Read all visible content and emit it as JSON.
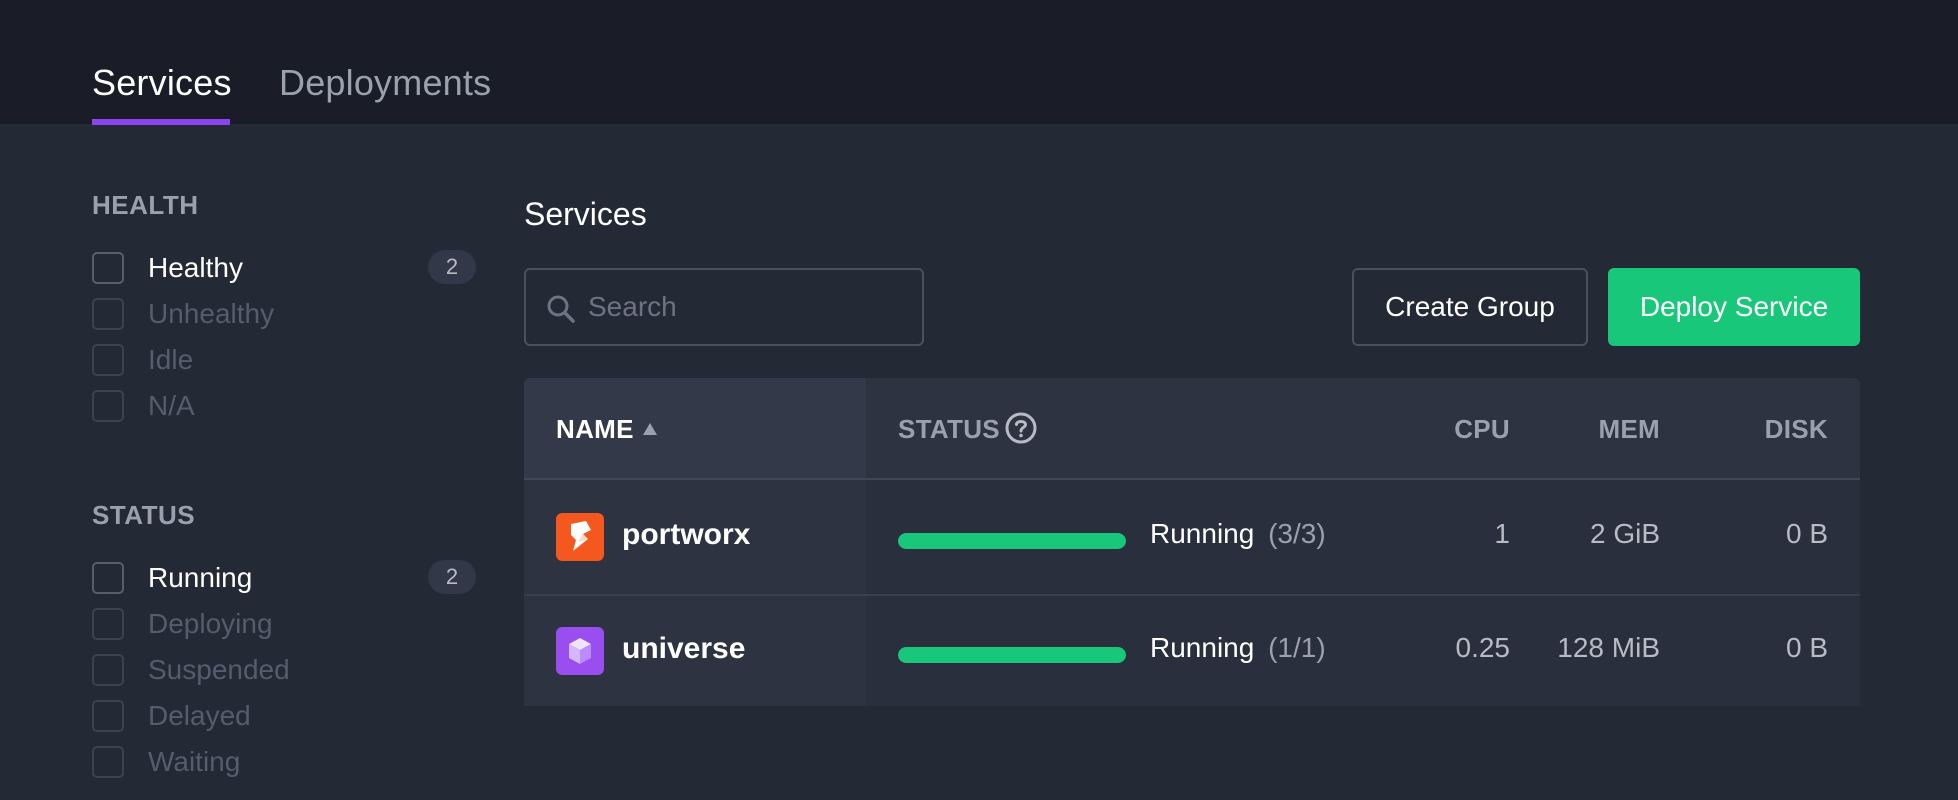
{
  "tabs": [
    {
      "label": "Services",
      "active": true
    },
    {
      "label": "Deployments",
      "active": false
    }
  ],
  "sidebar": {
    "health": {
      "title": "HEALTH",
      "items": [
        {
          "label": "Healthy",
          "count": "2",
          "enabled": true
        },
        {
          "label": "Unhealthy",
          "enabled": false
        },
        {
          "label": "Idle",
          "enabled": false
        },
        {
          "label": "N/A",
          "enabled": false
        }
      ]
    },
    "status": {
      "title": "STATUS",
      "items": [
        {
          "label": "Running",
          "count": "2",
          "enabled": true
        },
        {
          "label": "Deploying",
          "enabled": false
        },
        {
          "label": "Suspended",
          "enabled": false
        },
        {
          "label": "Delayed",
          "enabled": false
        },
        {
          "label": "Waiting",
          "enabled": false
        }
      ]
    }
  },
  "main": {
    "title": "Services",
    "search": {
      "placeholder": "Search",
      "value": ""
    },
    "buttons": {
      "create_group": "Create Group",
      "deploy_service": "Deploy Service"
    }
  },
  "table": {
    "headers": {
      "name": "NAME",
      "status": "STATUS",
      "cpu": "CPU",
      "mem": "MEM",
      "disk": "DISK"
    },
    "sort": {
      "column": "name",
      "direction": "ascending",
      "icon": "sort-ascending-icon"
    },
    "rows": [
      {
        "name": "portworx",
        "icon": "portworx-logo-icon",
        "icon_color": "#f5581f",
        "status": "Running",
        "instances": "(3/3)",
        "progress": 1.0,
        "cpu": "1",
        "mem": "2 GiB",
        "disk": "0 B"
      },
      {
        "name": "universe",
        "icon": "universe-cube-icon",
        "icon_color": "#9b4ef0",
        "status": "Running",
        "instances": "(1/1)",
        "progress": 1.0,
        "cpu": "0.25",
        "mem": "128 MiB",
        "disk": "0 B"
      }
    ]
  },
  "colors": {
    "accent_tab": "#8b44f0",
    "primary_button": "#19c77a",
    "progress": "#19c77a",
    "background": "#242936",
    "topbar": "#1a1d28"
  }
}
